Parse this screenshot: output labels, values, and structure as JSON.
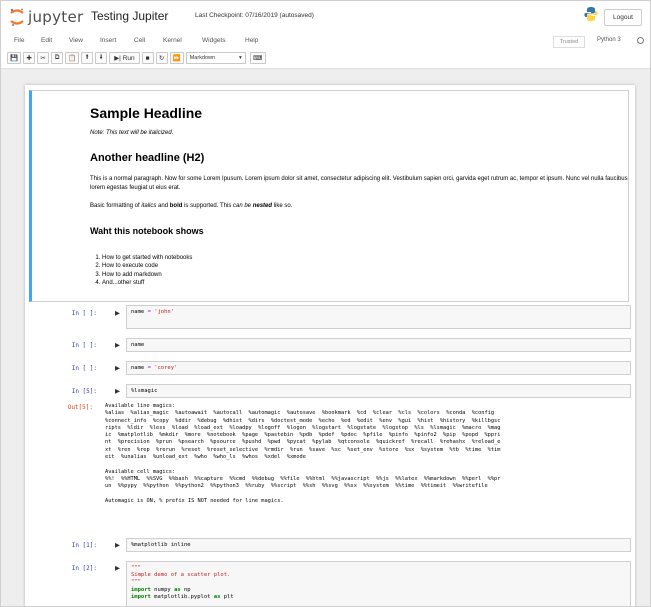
{
  "header": {
    "logo_text": "jupyter",
    "notebook_title": "Testing Jupiter",
    "checkpoint": "Last Checkpoint: 07/16/2019  (autosaved)",
    "logout_label": "Logout"
  },
  "menu": [
    "File",
    "Edit",
    "View",
    "Insert",
    "Cell",
    "Kernel",
    "Widgets",
    "Help"
  ],
  "kernel": {
    "trusted_label": "Trusted",
    "name": "Python 3"
  },
  "toolbar": {
    "run_label": "Run",
    "cell_type": "Markdown"
  },
  "markdown": {
    "h1": "Sample Headline",
    "note": "Note: This text will be italicized.",
    "h2": "Another headline (H2)",
    "para1": "This is a normal paragraph. Now for some Lorem Ipusum. Lorem ipsum dolor sit amet, consectetur adipiscing elit. Vestibulum sapien orci, garvida eget rutrum ac, tempor et ipsum. Nunc vel nulla faucibus lorem egestas feugiat ut eius erat.",
    "para2_a": "Basic formatting of ",
    "para2_italics": "italics",
    "para2_b": " and ",
    "para2_bold": "bold",
    "para2_c": " is supported. This ",
    "para2_can": "can be",
    "para2_nested": "nested",
    "para2_d": " like so.",
    "h3": "Waht this notebook shows",
    "list": [
      "How to get started with notebooks",
      "How to execute code",
      "How to add markdown",
      "And...other stuff"
    ]
  },
  "cells": {
    "c1": {
      "prompt": "In [ ]:",
      "var": "name",
      "op": "=",
      "str": "'john'"
    },
    "c2": {
      "prompt": "In [ ]:",
      "code": "name"
    },
    "c3": {
      "prompt": "In [ ]:",
      "var": "name",
      "op": "=",
      "str": "'corey'"
    },
    "c4": {
      "prompt": "In [5]:",
      "code": "%lsmagic",
      "out_prompt": "Out[5]:",
      "output": "Available line magics:\n%alias  %alias_magic  %autoawait  %autocall  %automagic  %autosave  %bookmark  %cd  %clear  %cls  %colors  %conda  %config\n%connect_info  %copy  %ddir  %debug  %dhist  %dirs  %doctest_mode  %echo  %ed  %edit  %env  %gui  %hist  %history  %killbgsc\nripts  %ldir  %less  %load  %load_ext  %loadpy  %logoff  %logon  %logstart  %logstate  %logstop  %ls  %lsmagic  %macro  %mag\nic  %matplotlib  %mkdir  %more  %notebook  %page  %pastebin  %pdb  %pdef  %pdoc  %pfile  %pinfo  %pinfo2  %pip  %popd  %ppri\nnt  %precision  %prun  %psearch  %psource  %pushd  %pwd  %pycat  %pylab  %qtconsole  %quickref  %recall  %rehashx  %reload_e\nxt  %ren  %rep  %rerun  %reset  %reset_selective  %rmdir  %run  %save  %sc  %set_env  %store  %sx  %system  %tb  %time  %tim\neit  %unalias  %unload_ext  %who  %who_ls  %whos  %xdel  %xmode\n\nAvailable cell magics:\n%%!  %%HTML  %%SVG  %%bash  %%capture  %%cmd  %%debug  %%file  %%html  %%javascript  %%js  %%latex  %%markdown  %%perl  %%pr\nun  %%pypy  %%python  %%python2  %%python3  %%ruby  %%script  %%sh  %%svg  %%sx  %%system  %%time  %%timeit  %%writefile\n\nAutomagic is ON, % prefix IS NOT needed for line magics."
    },
    "c5": {
      "prompt": "In [1]:",
      "code": "%matplotlib inline"
    },
    "c6": {
      "prompt": "In [2]:",
      "doc_open": "\"\"\"",
      "doc_line": "Simple demo of a scatter plot.",
      "doc_close": "\"\"\"",
      "import_kw": "import",
      "mod1": " numpy ",
      "as_kw": "as",
      "alias1": " np",
      "mod2": " matplotlib.pyplot ",
      "alias2": " plt"
    }
  }
}
